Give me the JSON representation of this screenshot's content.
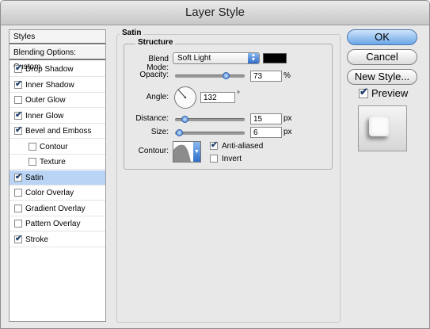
{
  "window": {
    "title": "Layer Style"
  },
  "styles_list": {
    "header": "Styles",
    "blending_options": "Blending Options: Custom",
    "items": [
      {
        "label": "Drop Shadow",
        "checked": true,
        "indent": false,
        "selected": false
      },
      {
        "label": "Inner Shadow",
        "checked": true,
        "indent": false,
        "selected": false
      },
      {
        "label": "Outer Glow",
        "checked": false,
        "indent": false,
        "selected": false
      },
      {
        "label": "Inner Glow",
        "checked": true,
        "indent": false,
        "selected": false
      },
      {
        "label": "Bevel and Emboss",
        "checked": true,
        "indent": false,
        "selected": false
      },
      {
        "label": "Contour",
        "checked": false,
        "indent": true,
        "selected": false
      },
      {
        "label": "Texture",
        "checked": false,
        "indent": true,
        "selected": false
      },
      {
        "label": "Satin",
        "checked": true,
        "indent": false,
        "selected": true
      },
      {
        "label": "Color Overlay",
        "checked": false,
        "indent": false,
        "selected": false
      },
      {
        "label": "Gradient Overlay",
        "checked": false,
        "indent": false,
        "selected": false
      },
      {
        "label": "Pattern Overlay",
        "checked": false,
        "indent": false,
        "selected": false
      },
      {
        "label": "Stroke",
        "checked": true,
        "indent": false,
        "selected": false
      }
    ]
  },
  "satin": {
    "title": "Satin",
    "structure_title": "Structure",
    "blend_mode_label": "Blend Mode:",
    "blend_mode_value": "Soft Light",
    "blend_color": "#000000",
    "opacity_label": "Opacity:",
    "opacity_value": "73",
    "opacity_unit": "%",
    "opacity_fraction": 0.73,
    "angle_label": "Angle:",
    "angle_value": "132",
    "angle_unit": "°",
    "distance_label": "Distance:",
    "distance_value": "15",
    "distance_unit": "px",
    "size_label": "Size:",
    "size_value": "6",
    "size_unit": "px",
    "contour_label": "Contour:",
    "anti_aliased_label": "Anti-aliased",
    "anti_aliased_checked": true,
    "invert_label": "Invert",
    "invert_checked": false
  },
  "buttons": {
    "ok": "OK",
    "cancel": "Cancel",
    "new_style": "New Style..."
  },
  "preview": {
    "label": "Preview",
    "checked": true
  },
  "colors": {
    "selection": "#b9d4f4",
    "accent": "#3d7ed6"
  }
}
